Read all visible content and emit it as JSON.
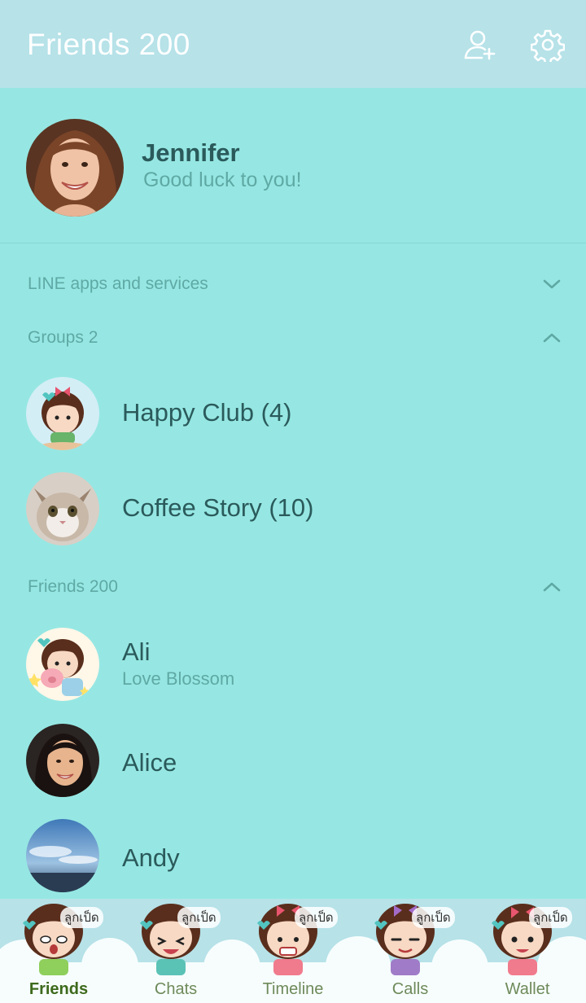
{
  "header": {
    "title": "Friends 200",
    "add_friend_icon": "add-friend-icon",
    "settings_icon": "gear-icon",
    "background": "#b6e2e8"
  },
  "profile": {
    "name": "Jennifer",
    "status": "Good luck to you!"
  },
  "sections": {
    "services": {
      "label": "LINE apps and services",
      "expanded": false
    },
    "groups": {
      "label": "Groups 2",
      "expanded": true
    },
    "friends": {
      "label": "Friends 200",
      "expanded": true
    }
  },
  "groups": [
    {
      "name": "Happy Club (4)"
    },
    {
      "name": "Coffee Story (10)"
    }
  ],
  "friends": [
    {
      "name": "Ali",
      "status": "Love Blossom"
    },
    {
      "name": "Alice"
    },
    {
      "name": "Andy"
    }
  ],
  "tabs": [
    {
      "label": "Friends",
      "badge": "ลูกเป็ด",
      "active": true
    },
    {
      "label": "Chats",
      "badge": "ลูกเป็ด",
      "active": false
    },
    {
      "label": "Timeline",
      "badge": "ลูกเป็ด",
      "active": false
    },
    {
      "label": "Calls",
      "badge": "ลูกเป็ด",
      "active": false
    },
    {
      "label": "Wallet",
      "badge": "ลูกเป็ด",
      "active": false
    }
  ],
  "colors": {
    "background": "#96e7e3",
    "text_dark": "#2b5a5b",
    "text_muted": "#5fa9a5"
  }
}
